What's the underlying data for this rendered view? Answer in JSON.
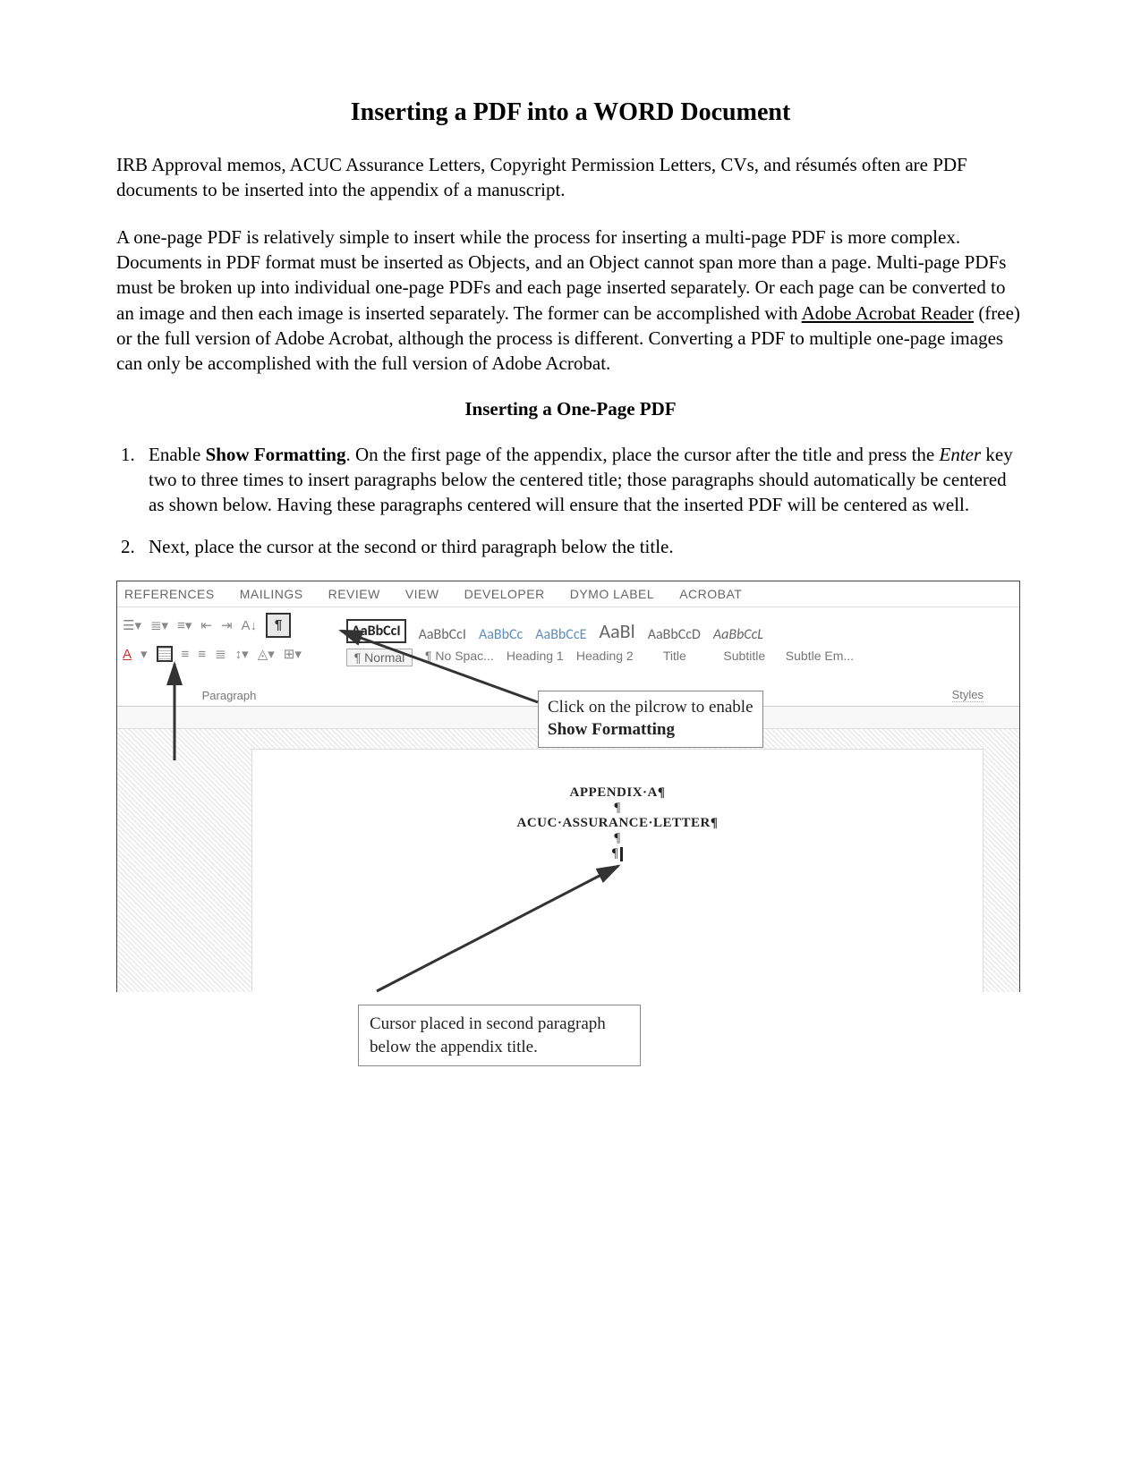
{
  "title": "Inserting a PDF into a WORD Document",
  "intro1": "IRB Approval memos, ACUC Assurance Letters, Copyright Permission Letters, CVs, and résumés often are PDF documents to be inserted into the appendix of a manuscript.",
  "intro2_a": "A one-page PDF is relatively simple to insert while the process for inserting a multi-page PDF is more complex. Documents in PDF format must be inserted as Objects, and an Object cannot span more than a page. Multi-page PDFs must be broken up into individual one-page PDFs and each page inserted separately. Or each page can be converted to an image and then each image is inserted separately. The former can be accomplished with ",
  "intro2_link": "Adobe Acrobat Reader",
  "intro2_b": " (free) or the full version of Adobe Acrobat, although the process is different. Converting a PDF to multiple one-page images can only be accomplished with the full version of Adobe Acrobat.",
  "section1": "Inserting a One-Page PDF",
  "step1_a": "Enable ",
  "step1_bold": "Show Formatting",
  "step1_b": ". On the first page of the appendix, place the cursor after the title and press the ",
  "step1_italic": "Enter",
  "step1_c": " key two to three times to insert paragraphs below the centered title; those paragraphs should automatically be centered as shown below. Having these paragraphs centered will ensure that the inserted PDF will be centered as well.",
  "step2": "Next, place the cursor at the second or third paragraph below the title.",
  "ribbon": {
    "tabs": [
      "REFERENCES",
      "MAILINGS",
      "REVIEW",
      "VIEW",
      "DEVELOPER",
      "DYMO Label",
      "ACROBAT"
    ],
    "paragraph_label": "Paragraph",
    "pilcrow": "¶",
    "styles_label": "Styles",
    "style_previews": [
      "AaBbCcI",
      "AaBbCcI",
      "AaBbCc",
      "AaBbCcE",
      "AaBl",
      "AaBbCcD",
      "AaBbCcL"
    ],
    "style_names": [
      "¶ Normal",
      "¶ No Spac...",
      "Heading 1",
      "Heading 2",
      "Title",
      "Subtitle",
      "Subtle Em..."
    ]
  },
  "callout1_a": "Click on the pilcrow to enable ",
  "callout1_b": "Show Formatting",
  "doc": {
    "line1": "APPENDIX·A¶",
    "pil": "¶",
    "line2": "ACUC·ASSURANCE·LETTER¶"
  },
  "callout2": "Cursor placed in second paragraph below the appendix title."
}
